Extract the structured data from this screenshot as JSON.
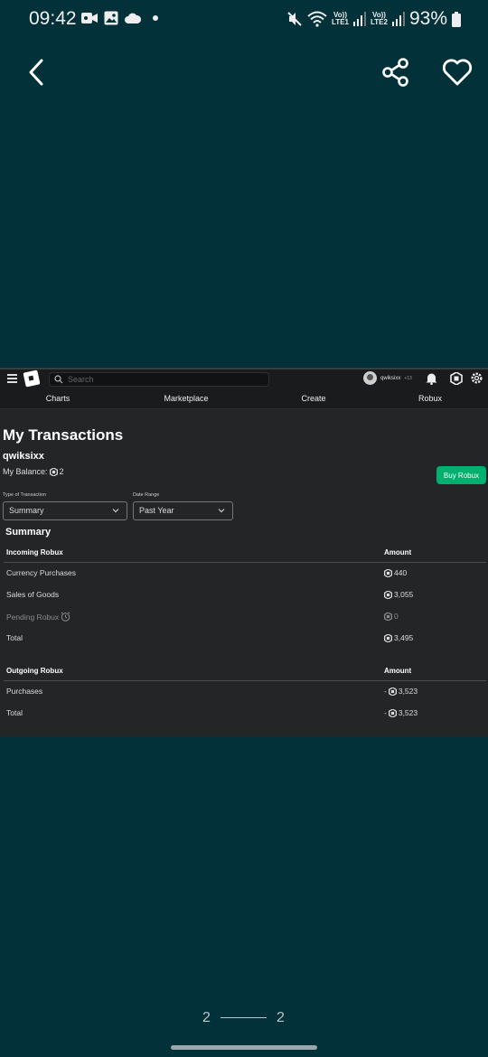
{
  "status_bar": {
    "time": "09:42",
    "lte1": "LTE1",
    "lte2": "LTE2",
    "volte": "Vo))",
    "battery": "93%"
  },
  "viewer": {
    "page_current": "2",
    "page_total": "2"
  },
  "roblox": {
    "search_placeholder": "Search",
    "username_nav": "qwiksixx",
    "age": "+13",
    "tabs": [
      "Charts",
      "Marketplace",
      "Create",
      "Robux"
    ],
    "page_title": "My Transactions",
    "username": "qwiksixx",
    "balance_label": "My Balance:",
    "balance_value": "2",
    "buy_button": "Buy Robux",
    "type_label": "Type of Transaction",
    "type_value": "Summary",
    "range_label": "Date Range",
    "range_value": "Past Year",
    "summary_heading": "Summary",
    "incoming": {
      "header": "Incoming Robux",
      "amount_header": "Amount",
      "rows": [
        {
          "label": "Currency Purchases",
          "amount": "440"
        },
        {
          "label": "Sales of Goods",
          "amount": "3,055"
        },
        {
          "label": "Pending Robux",
          "amount": "0"
        },
        {
          "label": "Total",
          "amount": "3,495"
        }
      ]
    },
    "outgoing": {
      "header": "Outgoing Robux",
      "amount_header": "Amount",
      "rows": [
        {
          "label": "Purchases",
          "amount": "3,523",
          "sign": "-"
        },
        {
          "label": "Total",
          "amount": "3,523",
          "sign": "-"
        }
      ]
    }
  }
}
